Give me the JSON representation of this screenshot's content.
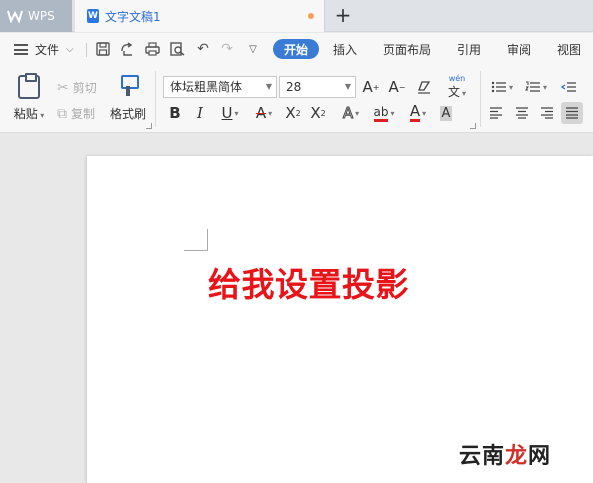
{
  "tabs": {
    "home_tab": "WPS",
    "document_tab": "文字文稿1",
    "doc_icon_letter": "W",
    "new_tab_symbol": "+"
  },
  "menu": {
    "file": "文件",
    "items": [
      "开始",
      "插入",
      "页面布局",
      "引用",
      "审阅",
      "视图"
    ],
    "active_index": 0
  },
  "ribbon": {
    "paste": "粘贴",
    "cut": "剪切",
    "copy": "复制",
    "format_painter": "格式刷",
    "font_name": "体坛粗黑简体",
    "font_size": "28",
    "phonetic_label": "wén"
  },
  "document": {
    "text": "给我设置投影",
    "text_color": "#e8141a"
  },
  "watermark": {
    "part1": "云南",
    "part2": "龙",
    "part3": "网"
  },
  "colors": {
    "accent": "#3a7bd5",
    "tab_doc_title": "#2b6ed4",
    "unsaved_dot": "#f2a154"
  }
}
